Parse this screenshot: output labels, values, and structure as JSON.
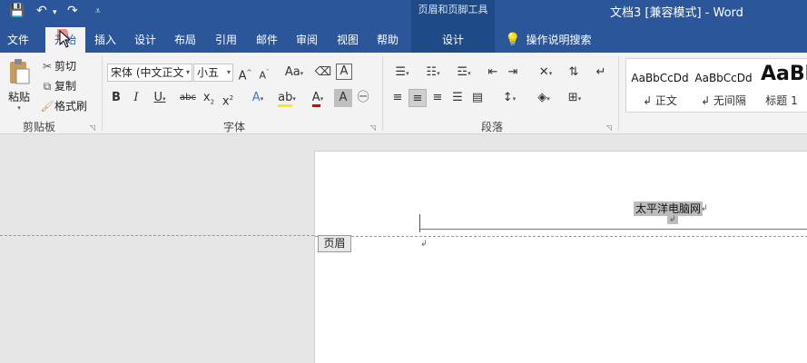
{
  "titlebar": {
    "context_tools_title": "页眉和页脚工具",
    "document_title": "文档3 [兼容模式]  -  Word",
    "quick_access": {
      "save": "💾",
      "undo": "↶",
      "undo_dd": "▾",
      "redo": "↷",
      "customize": "⩡"
    }
  },
  "tabs": [
    {
      "label": "文件"
    },
    {
      "label": "开始"
    },
    {
      "label": "插入"
    },
    {
      "label": "设计"
    },
    {
      "label": "布局"
    },
    {
      "label": "引用"
    },
    {
      "label": "邮件"
    },
    {
      "label": "审阅"
    },
    {
      "label": "视图"
    },
    {
      "label": "帮助"
    },
    {
      "label": "设计"
    }
  ],
  "tell_me": "操作说明搜索",
  "ribbon": {
    "clipboard": {
      "label": "剪贴板",
      "paste": "粘贴",
      "cut": "剪切",
      "copy": "复制",
      "format_painter": "格式刷"
    },
    "font": {
      "label": "字体",
      "font_name": "宋体 (中文正文",
      "font_size": "小五"
    },
    "paragraph": {
      "label": "段落"
    },
    "styles": [
      {
        "sample": "AaBbCcDd",
        "name": "↲ 正文"
      },
      {
        "sample": "AaBbCcDd",
        "name": "↲ 无间隔"
      },
      {
        "sample": "AaBl",
        "name": "标题 1"
      }
    ]
  },
  "document": {
    "header_text": "太平洋电脑网",
    "para_mark": "↲",
    "header_tag": "页眉"
  },
  "colors": {
    "accent": "#2b579a",
    "context": "#1e4a86",
    "ribbon": "#f3f3f3"
  }
}
